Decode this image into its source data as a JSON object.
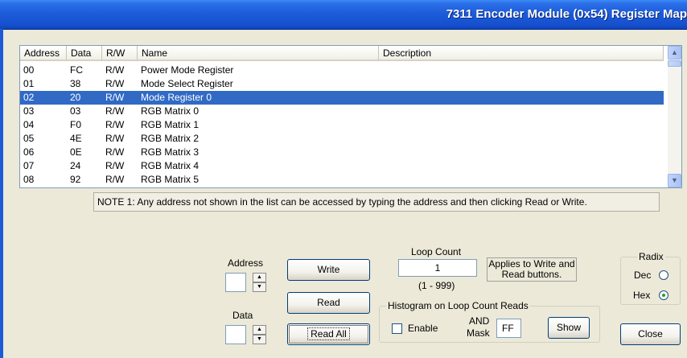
{
  "window": {
    "title": "7311 Encoder Module (0x54) Register Map"
  },
  "register_list": {
    "columns": [
      "Address",
      "Data",
      "R/W",
      "Name",
      "Description"
    ],
    "selected_index": 2,
    "rows": [
      {
        "address": "00",
        "data": "FC",
        "rw": "R/W",
        "name": "Power Mode Register",
        "description": ""
      },
      {
        "address": "01",
        "data": "38",
        "rw": "R/W",
        "name": "Mode Select Register",
        "description": ""
      },
      {
        "address": "02",
        "data": "20",
        "rw": "R/W",
        "name": "Mode Register 0",
        "description": ""
      },
      {
        "address": "03",
        "data": "03",
        "rw": "R/W",
        "name": "RGB Matrix 0",
        "description": ""
      },
      {
        "address": "04",
        "data": "F0",
        "rw": "R/W",
        "name": "RGB Matrix 1",
        "description": ""
      },
      {
        "address": "05",
        "data": "4E",
        "rw": "R/W",
        "name": "RGB Matrix 2",
        "description": ""
      },
      {
        "address": "06",
        "data": "0E",
        "rw": "R/W",
        "name": "RGB Matrix 3",
        "description": ""
      },
      {
        "address": "07",
        "data": "24",
        "rw": "R/W",
        "name": "RGB Matrix 4",
        "description": ""
      },
      {
        "address": "08",
        "data": "92",
        "rw": "R/W",
        "name": "RGB Matrix 5",
        "description": ""
      }
    ]
  },
  "note": "NOTE 1: Any address not shown in the list can be accessed by typing the address and then clicking Read or Write.",
  "controls": {
    "address_label": "Address",
    "address_value": "",
    "data_label": "Data",
    "data_value": "",
    "write_label": "Write",
    "read_label": "Read",
    "read_all_label": "Read All",
    "loop_count_label": "Loop Count",
    "loop_count_value": "1",
    "loop_range": "(1 - 999)",
    "applies_note": "Applies to Write and Read buttons.",
    "histogram_label": "Histogram on Loop Count Reads",
    "enable_label": "Enable",
    "enable_checked": false,
    "and_label": "AND",
    "mask_label": "Mask",
    "mask_value": "FF",
    "show_label": "Show",
    "radix_label": "Radix",
    "dec_label": "Dec",
    "hex_label": "Hex",
    "radix_selected": "Hex",
    "close_label": "Close"
  },
  "icons": {
    "scroll_up": "chevron-up-icon",
    "scroll_down": "chevron-down-icon",
    "spin_up": "spin-up-icon",
    "spin_down": "spin-down-icon"
  },
  "colors": {
    "title_bar": "#1c5ad8",
    "selection": "#316ac5",
    "dialog_bg": "#ece9d8"
  }
}
